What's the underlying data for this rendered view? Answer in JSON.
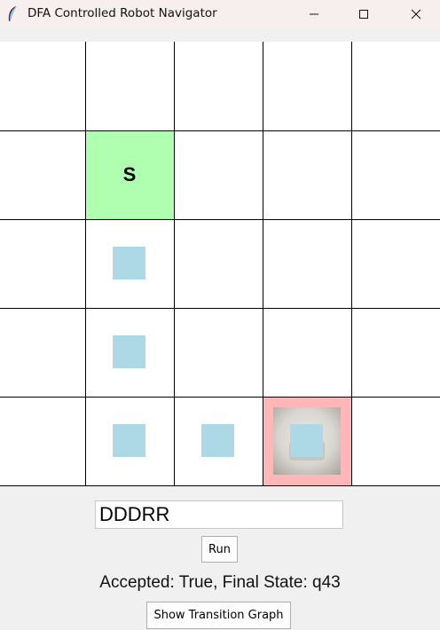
{
  "window": {
    "title": "DFA Controlled Robot Navigator",
    "app_icon": "feather-icon",
    "controls": [
      "minimize-icon",
      "maximize-icon",
      "close-icon"
    ]
  },
  "grid": {
    "rows": 5,
    "cols": 5,
    "start": {
      "row": 1,
      "col": 1,
      "label": "S"
    },
    "goal": {
      "row": 4,
      "col": 3
    },
    "path": [
      {
        "row": 2,
        "col": 1
      },
      {
        "row": 3,
        "col": 1
      },
      {
        "row": 4,
        "col": 1
      },
      {
        "row": 4,
        "col": 2
      },
      {
        "row": 4,
        "col": 3
      }
    ],
    "colors": {
      "start": "#b0ffb0",
      "goal": "#ffb6b6",
      "path": "#add8e6",
      "grid_lines": "#000000"
    }
  },
  "input": {
    "value": "DDDRR"
  },
  "run_button": {
    "label": "Run"
  },
  "result": {
    "text": "Accepted: True, Final State: q43"
  },
  "graph_button": {
    "label": "Show Transition Graph"
  }
}
